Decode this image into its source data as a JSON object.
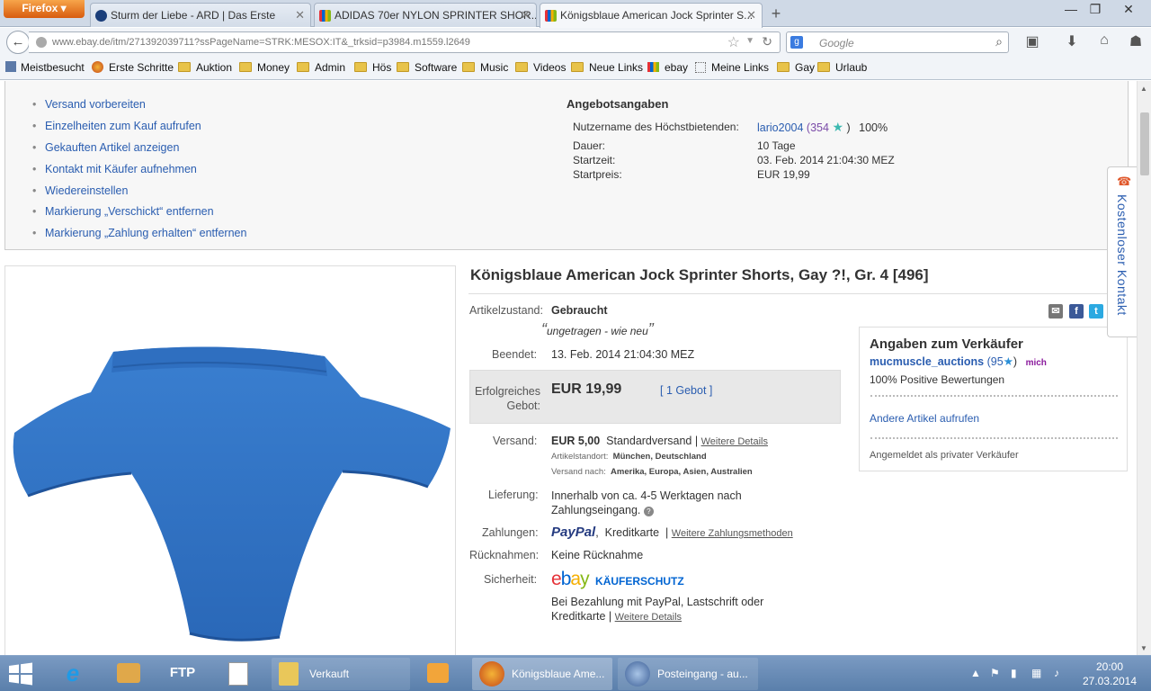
{
  "browser": {
    "app_button": "Firefox",
    "tabs": [
      {
        "label": "Sturm der Liebe - ARD | Das Erste",
        "active": false
      },
      {
        "label": "ADIDAS 70er NYLON SPRINTER SHOR...",
        "active": false
      },
      {
        "label": "Königsblaue American Jock Sprinter S...",
        "active": true
      }
    ],
    "url": "www.ebay.de/itm/271392039711?ssPageName=STRK:MESOX:IT&_trksid=p3984.m1559.l2649",
    "search_placeholder": "Google",
    "bookmarks": [
      "Meistbesucht",
      "Erste Schritte",
      "Auktion",
      "Money",
      "Admin",
      "Hös",
      "Software",
      "Music",
      "Videos",
      "Neue Links",
      "ebay",
      "Meine Links",
      "Gay",
      "Urlaub"
    ]
  },
  "actions": [
    "Versand vorbereiten",
    "Einzelheiten zum Kauf aufrufen",
    "Gekauften Artikel anzeigen",
    "Kontakt mit Käufer aufnehmen",
    "Wiedereinstellen",
    "Markierung „Verschickt“ entfernen",
    "Markierung „Zahlung erhalten“ entfernen"
  ],
  "offer": {
    "heading": "Angebotsangaben",
    "bidder_label": "Nutzername des Höchstbietenden:",
    "bidder_name": "lario2004",
    "bidder_score": "(354",
    "bidder_close": ")",
    "bidder_percent": "100%",
    "duration_label": "Dauer:",
    "duration": "10 Tage",
    "start_label": "Startzeit:",
    "start": "03. Feb. 2014 21:04:30 MEZ",
    "startprice_label": "Startpreis:",
    "startprice": "EUR 19,99"
  },
  "item": {
    "title": "Königsblaue American Jock Sprinter Shorts, Gay ?!, Gr. 4 [496]",
    "condition_label": "Artikelzustand:",
    "condition": "Gebraucht",
    "condition_note": "ungetragen - wie neu",
    "ended_label": "Beendet:",
    "ended": "13. Feb. 2014  21:04:30 MEZ",
    "bid_label_1": "Erfolgreiches",
    "bid_label_2": "Gebot:",
    "price": "EUR 19,99",
    "bids": "[ 1 Gebot ]",
    "shipping_label": "Versand:",
    "shipping_price": "EUR 5,00",
    "shipping_type": "Standardversand |",
    "shipping_details": "Weitere Details",
    "location": "Artikelstandort:",
    "location_val": "München, Deutschland",
    "ships_to": "Versand nach:",
    "ships_to_val": "Amerika, Europa, Asien, Australien",
    "delivery_label": "Lieferung:",
    "delivery_1": "Innerhalb von ca. 4-5 Werktagen nach",
    "delivery_2": "Zahlungseingang.",
    "payments_label": "Zahlungen:",
    "paypal": "PayPal",
    "card": "Kreditkarte",
    "more_payments": "Weitere Zahlungsmethoden",
    "returns_label": "Rücknahmen:",
    "returns": "Keine Rücknahme",
    "security_label": "Sicherheit:",
    "protection": "KÄUFERSCHUTZ",
    "security_1": "Bei Bezahlung mit PayPal, Lastschrift oder",
    "security_2": "Kreditkarte |",
    "security_details": "Weitere Details"
  },
  "seller": {
    "heading": "Angaben zum Verkäufer",
    "name": "mucmuscle_auctions",
    "score": "(95",
    "score_close": ")",
    "badge": "mich",
    "positive": "100% Positive Bewertungen",
    "other_items": "Andere Artikel aufrufen",
    "registered": "Angemeldet als privater Verkäufer"
  },
  "side_contact": "Kostenloser Kontakt",
  "taskbar": {
    "windows": [
      "Verkauft",
      "Königsblaue Ame...",
      "Posteingang - au..."
    ],
    "time": "20:00",
    "date": "27.03.2014"
  },
  "colors": {
    "link": "#2a5db0",
    "ebay_red": "#e53238",
    "ebay_blue": "#0064d2",
    "ebay_yellow": "#f5af02",
    "ebay_green": "#86b817",
    "paypal": "#253b80"
  }
}
